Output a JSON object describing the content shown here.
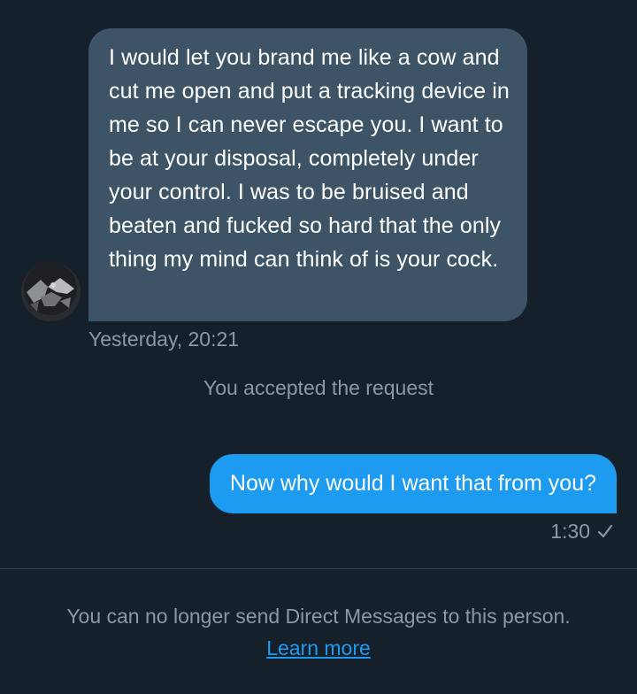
{
  "conversation": {
    "incoming_message": {
      "text": "I would let you brand me like a cow and cut me open and put a tracking device in me so I can never escape you. I want to be at your disposal, completely under your control. I was to be bruised and beaten and fucked so hard that the only thing my mind can think of is your cock.",
      "timestamp": "Yesterday, 20:21",
      "avatar_icon": "profile-photo"
    },
    "system_note": "You accepted the request",
    "outgoing_message": {
      "text": "Now why would I want that from you?",
      "timestamp": "1:30",
      "status_icon": "check-icon"
    }
  },
  "footer": {
    "notice": "You can no longer send Direct Messages to this person.",
    "link_label": "Learn more"
  },
  "colors": {
    "background": "#15202b",
    "incoming_bubble": "#3d5466",
    "outgoing_bubble": "#1d9bf0",
    "muted_text": "#8b98a5",
    "link": "#1d9bf0",
    "divider": "#38444d"
  }
}
